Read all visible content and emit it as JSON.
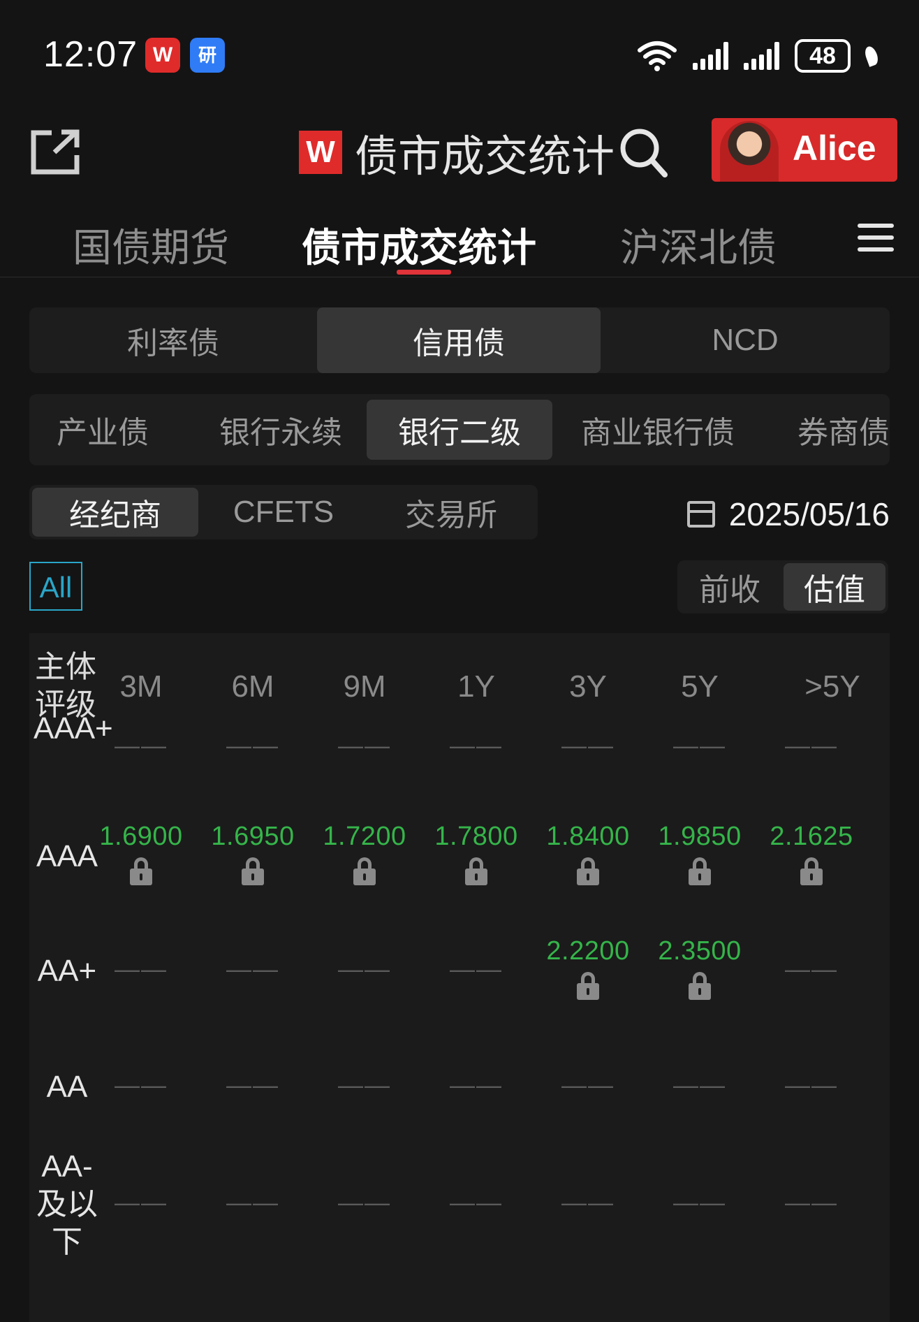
{
  "status_bar": {
    "time": "12:07",
    "badge_w": "W",
    "badge_yan": "研",
    "battery": "48"
  },
  "header": {
    "logo": "W",
    "title": "债市成交统计",
    "user_name": "Alice"
  },
  "main_tabs": [
    {
      "label": "国债期货"
    },
    {
      "label": "债市成交统计"
    },
    {
      "label": "沪深北债"
    }
  ],
  "bond_types": [
    {
      "label": "利率债"
    },
    {
      "label": "信用债"
    },
    {
      "label": "NCD"
    }
  ],
  "sub_types": [
    {
      "label": "产业债"
    },
    {
      "label": "银行永续"
    },
    {
      "label": "银行二级"
    },
    {
      "label": "商业银行债"
    },
    {
      "label": "券商债"
    }
  ],
  "sources": [
    {
      "label": "经纪商"
    },
    {
      "label": "CFETS"
    },
    {
      "label": "交易所"
    }
  ],
  "date": "2025/05/16",
  "filter_all": "All",
  "value_modes": [
    {
      "label": "前收"
    },
    {
      "label": "估值"
    }
  ],
  "table": {
    "rating_header": "主体评级",
    "columns": [
      "3M",
      "6M",
      "9M",
      "1Y",
      "3Y",
      "5Y",
      ">5Y"
    ],
    "empty": "——",
    "rows": [
      {
        "rating": "AAA+",
        "values": [
          "——",
          "——",
          "——",
          "——",
          "——",
          "——",
          "——"
        ]
      },
      {
        "rating": "AAA",
        "values": [
          "1.6900",
          "1.6950",
          "1.7200",
          "1.7800",
          "1.8400",
          "1.9850",
          "2.1625"
        ]
      },
      {
        "rating": "AA+",
        "values": [
          "——",
          "——",
          "——",
          "——",
          "2.2200",
          "2.3500",
          "——"
        ]
      },
      {
        "rating": "AA",
        "values": [
          "——",
          "——",
          "——",
          "——",
          "——",
          "——",
          "——"
        ]
      },
      {
        "rating": "AA-及以下",
        "values": [
          "——",
          "——",
          "——",
          "——",
          "——",
          "——",
          "——"
        ]
      }
    ]
  },
  "colors": {
    "accent_red": "#e0333a",
    "value_green": "#35b54a",
    "filter_blue": "#2aa6c9"
  }
}
